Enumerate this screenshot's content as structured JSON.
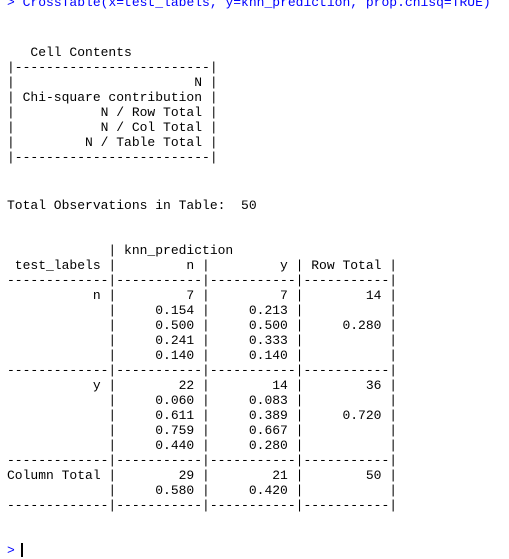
{
  "console": {
    "prompt": ">",
    "command": "CrossTable(x=test_labels, y=knn_prediction, prop.chisq=TRUE)"
  },
  "legend": {
    "title": "Cell Contents",
    "rule": "|-------------------------|",
    "rows": [
      "|                       N |",
      "| Chi-square contribution |",
      "|           N / Row Total |",
      "|           N / Col Total |",
      "|         N / Table Total |"
    ]
  },
  "summary": {
    "total_observations": "Total Observations in Table:  50"
  },
  "crosstab": {
    "header_lines": [
      "             | knn_prediction ",
      " test_labels |         n |         y | Row Total | "
    ],
    "rule_thin": "-------------|-----------|-----------|-----------|",
    "rule_bottom": "-------------|-----------|-----------|-----------|",
    "block_n": [
      "           n |         7 |         7 |        14 | ",
      "             |     0.154 |     0.213 |           | ",
      "             |     0.500 |     0.500 |     0.280 | ",
      "             |     0.241 |     0.333 |           | ",
      "             |     0.140 |     0.140 |           | "
    ],
    "block_y": [
      "           y |        22 |        14 |        36 | ",
      "             |     0.060 |     0.083 |           | ",
      "             |     0.611 |     0.389 |     0.720 | ",
      "             |     0.759 |     0.667 |           | ",
      "             |     0.440 |     0.280 |           | "
    ],
    "block_total": [
      "Column Total |        29 |        21 |        50 | ",
      "             |     0.580 |     0.420 |           | "
    ]
  }
}
